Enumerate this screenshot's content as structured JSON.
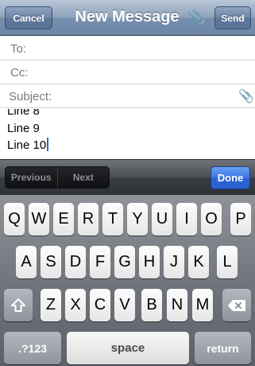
{
  "navbar": {
    "cancel_label": "Cancel",
    "title": "New Message",
    "send_label": "Send",
    "attachment_icon": "paperclip-icon"
  },
  "fields": {
    "to_label": "To:",
    "cc_label": "Cc:",
    "subject_label": "Subject:"
  },
  "body": {
    "lines": [
      "Line 8",
      "Line 9",
      "Line 10"
    ]
  },
  "accessory": {
    "previous_label": "Previous",
    "next_label": "Next",
    "done_label": "Done"
  },
  "keyboard": {
    "row1": [
      "Q",
      "W",
      "E",
      "R",
      "T",
      "Y",
      "U",
      "I",
      "O",
      "P"
    ],
    "row2": [
      "A",
      "S",
      "D",
      "F",
      "G",
      "H",
      "J",
      "K",
      "L"
    ],
    "row3": [
      "Z",
      "X",
      "C",
      "V",
      "B",
      "N",
      "M"
    ],
    "numbers_label": ".?123",
    "space_label": "space",
    "return_label": "return",
    "shift_icon": "shift-icon",
    "delete_icon": "delete-icon"
  }
}
